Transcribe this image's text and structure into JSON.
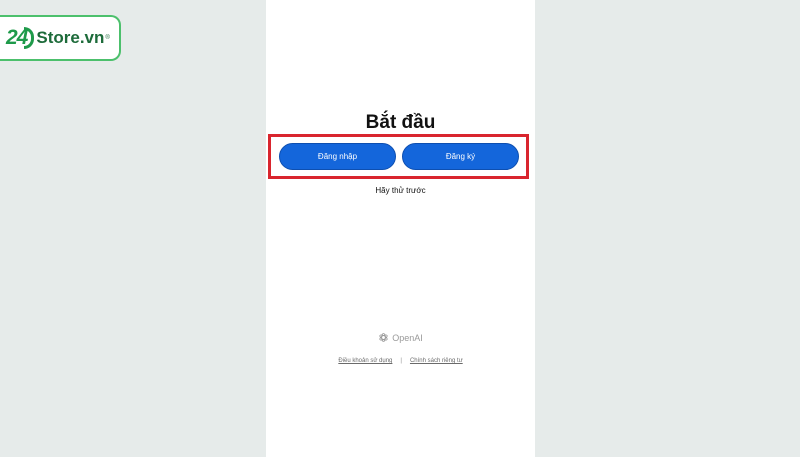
{
  "watermark": {
    "number": "24",
    "text": "Store.vn",
    "reg_mark": "®"
  },
  "screen": {
    "title": "Bắt đầu",
    "login_label": "Đăng nhập",
    "signup_label": "Đăng ký",
    "try_first_label": "Hãy thử trước",
    "brand_name": "OpenAI",
    "terms_label": "Điều khoản sử dụng",
    "separator": "|",
    "privacy_label": "Chính sách riêng tư"
  },
  "colors": {
    "accent": "#1466db",
    "highlight": "#d9252e",
    "watermark_green": "#1e9a4a",
    "background": "#e6ebea"
  },
  "icons": {
    "brand": "openai-logo-icon"
  }
}
